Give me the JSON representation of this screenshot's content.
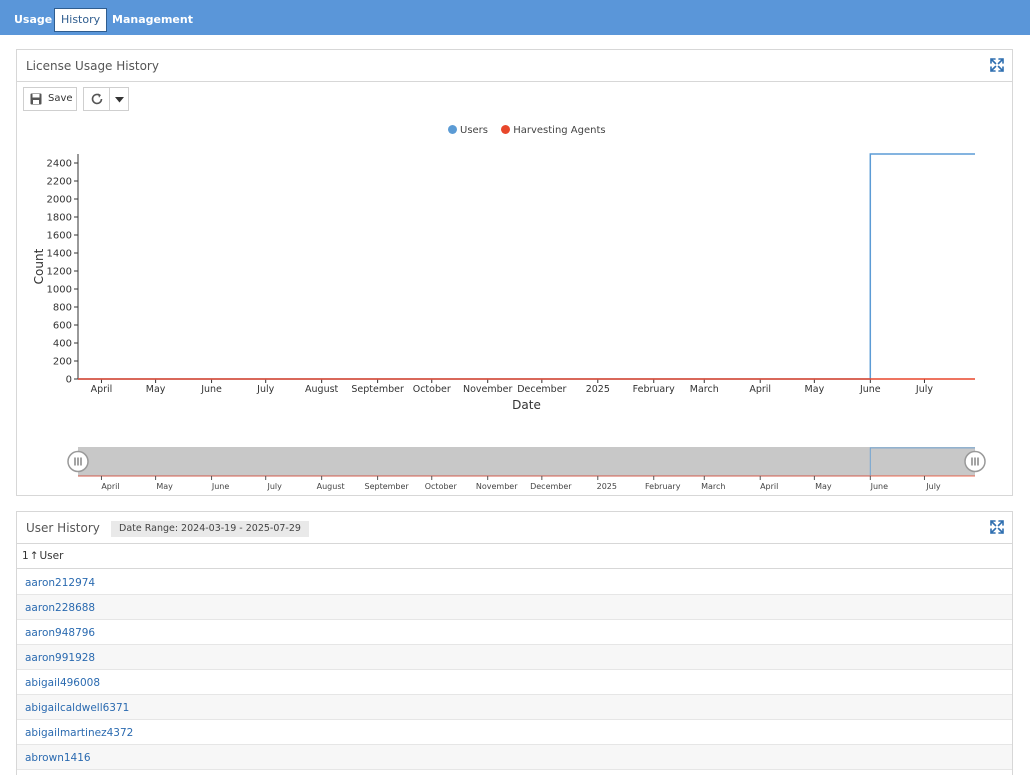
{
  "tabs": [
    "Usage",
    "History",
    "Management"
  ],
  "active_tab": "History",
  "license_panel": {
    "title": "License Usage History",
    "save_label": "Save"
  },
  "user_panel": {
    "title": "User History",
    "date_range": "Date Range: 2024-03-19 - 2025-07-29",
    "sort_indicator": "1",
    "column_header": "User",
    "rows": [
      "aaron212974",
      "aaron228688",
      "aaron948796",
      "aaron991928",
      "abigail496008",
      "abigailcaldwell6371",
      "abigailmartinez4372",
      "abrown1416"
    ]
  },
  "chart_data": {
    "type": "line",
    "xlabel": "Date",
    "ylabel": "Count",
    "x_tick_labels": [
      "April",
      "May",
      "June",
      "July",
      "August",
      "September",
      "October",
      "November",
      "December",
      "2025",
      "February",
      "March",
      "April",
      "May",
      "June",
      "July"
    ],
    "y_ticks": [
      0,
      200,
      400,
      600,
      800,
      1000,
      1200,
      1400,
      1600,
      1800,
      2000,
      2200,
      2400
    ],
    "ylim": [
      0,
      2500
    ],
    "xlim": [
      "2024-03-19",
      "2025-07-29"
    ],
    "legend_position": "top-center",
    "series": [
      {
        "name": "Users",
        "color": "#5b9bd5",
        "points": [
          [
            "2024-03-19",
            0
          ],
          [
            "2025-06-01",
            0
          ],
          [
            "2025-06-01",
            2500
          ],
          [
            "2025-07-29",
            2500
          ]
        ]
      },
      {
        "name": "Harvesting Agents",
        "color": "#e8472b",
        "points": [
          [
            "2024-03-19",
            0
          ],
          [
            "2025-07-29",
            0
          ]
        ]
      }
    ],
    "navigator": {
      "range": [
        "2024-03-19",
        "2025-07-29"
      ]
    }
  }
}
